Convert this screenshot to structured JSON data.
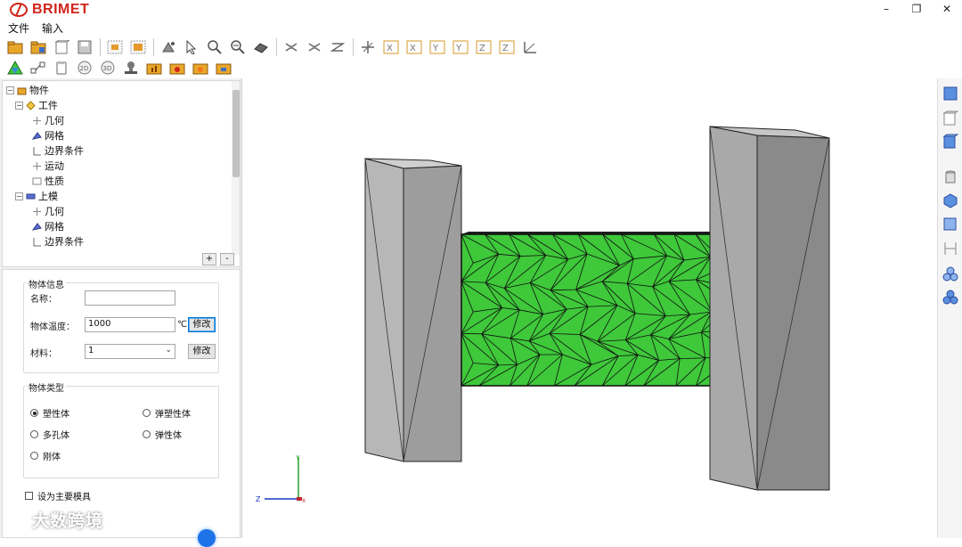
{
  "app": {
    "title": "BRIMET",
    "window_controls": [
      "minimize",
      "restore",
      "close"
    ]
  },
  "menu": [
    "文件",
    "输入"
  ],
  "toolbar": {
    "row1": [
      "folder-open-icon",
      "folder-save-icon",
      "new-document-icon",
      "save-disk-icon",
      "zoom-window-icon",
      "zoom-fit-icon",
      "pan-icon",
      "select-arrow-icon",
      "zoom-in-icon",
      "zoom-out-icon",
      "rotate-icon",
      "rotate-x-icon",
      "rotate-y-icon",
      "rotate-z-icon",
      "axis-origin-icon",
      "view-x-minus-icon",
      "view-x-plus-icon",
      "view-y-minus-icon",
      "view-y-plus-icon",
      "view-z-minus-icon",
      "view-z-plus-icon",
      "axis-measure-icon"
    ],
    "row2": [
      "mesh-triangle-icon",
      "flow-chart-icon",
      "clipboard-icon",
      "2d-icon",
      "3d-icon",
      "stamp-icon",
      "folder-chart-icon",
      "folder-red-icon",
      "folder-orange-icon",
      "folder-blue-icon"
    ]
  },
  "tree": {
    "items": [
      {
        "label": "物件",
        "level": 0,
        "icon": "object-icon",
        "expander": "-"
      },
      {
        "label": "工件",
        "level": 1,
        "icon": "workpiece-icon",
        "expander": "-"
      },
      {
        "label": "几何",
        "level": 2,
        "icon": "geometry-icon"
      },
      {
        "label": "网格",
        "level": 2,
        "icon": "mesh-icon"
      },
      {
        "label": "边界条件",
        "level": 2,
        "icon": "boundary-icon"
      },
      {
        "label": "运动",
        "level": 2,
        "icon": "motion-icon"
      },
      {
        "label": "性质",
        "level": 2,
        "icon": "property-icon"
      },
      {
        "label": "上模",
        "level": 1,
        "icon": "upper-die-icon",
        "expander": "-"
      },
      {
        "label": "几何",
        "level": 2,
        "icon": "geometry-icon"
      },
      {
        "label": "网格",
        "level": 2,
        "icon": "mesh-icon"
      },
      {
        "label": "边界条件",
        "level": 2,
        "icon": "boundary-icon"
      }
    ],
    "add_button": "+",
    "remove_button": "-"
  },
  "object_info": {
    "group_title": "物体信息",
    "name_label": "名称：",
    "name_value": "",
    "temperature_label": "物体温度：",
    "temperature_value": "1000",
    "temperature_unit": "℃",
    "modify_temp_button": "修改",
    "material_label": "材料：",
    "material_value": "1",
    "modify_material_button": "修改"
  },
  "object_type": {
    "group_title": "物体类型",
    "options": [
      {
        "label": "塑性体",
        "checked": true
      },
      {
        "label": "弹塑性体",
        "checked": false
      },
      {
        "label": "多孔体",
        "checked": false
      },
      {
        "label": "弹性体",
        "checked": false
      },
      {
        "label": "刚体",
        "checked": false
      }
    ]
  },
  "primary_die": {
    "label": "设为主要模具",
    "checked": false
  },
  "watermark": "大数跨境",
  "axes": {
    "vertical": "Y",
    "horizontal": "Z",
    "origin": "X"
  },
  "colors": {
    "mesh_green": "#3ec83a",
    "die_light": "#b5b5b5",
    "die_mid": "#9c9c9c",
    "die_dark": "#8a8a8a",
    "brand_red": "#d0241b"
  },
  "right_toolbar": [
    "view-front-icon",
    "view-back-icon",
    "view-iso-icon",
    "cylinder-icon",
    "box-icon",
    "cube-icon",
    "dimension-icon",
    "group-icon",
    "group-alt-icon"
  ]
}
